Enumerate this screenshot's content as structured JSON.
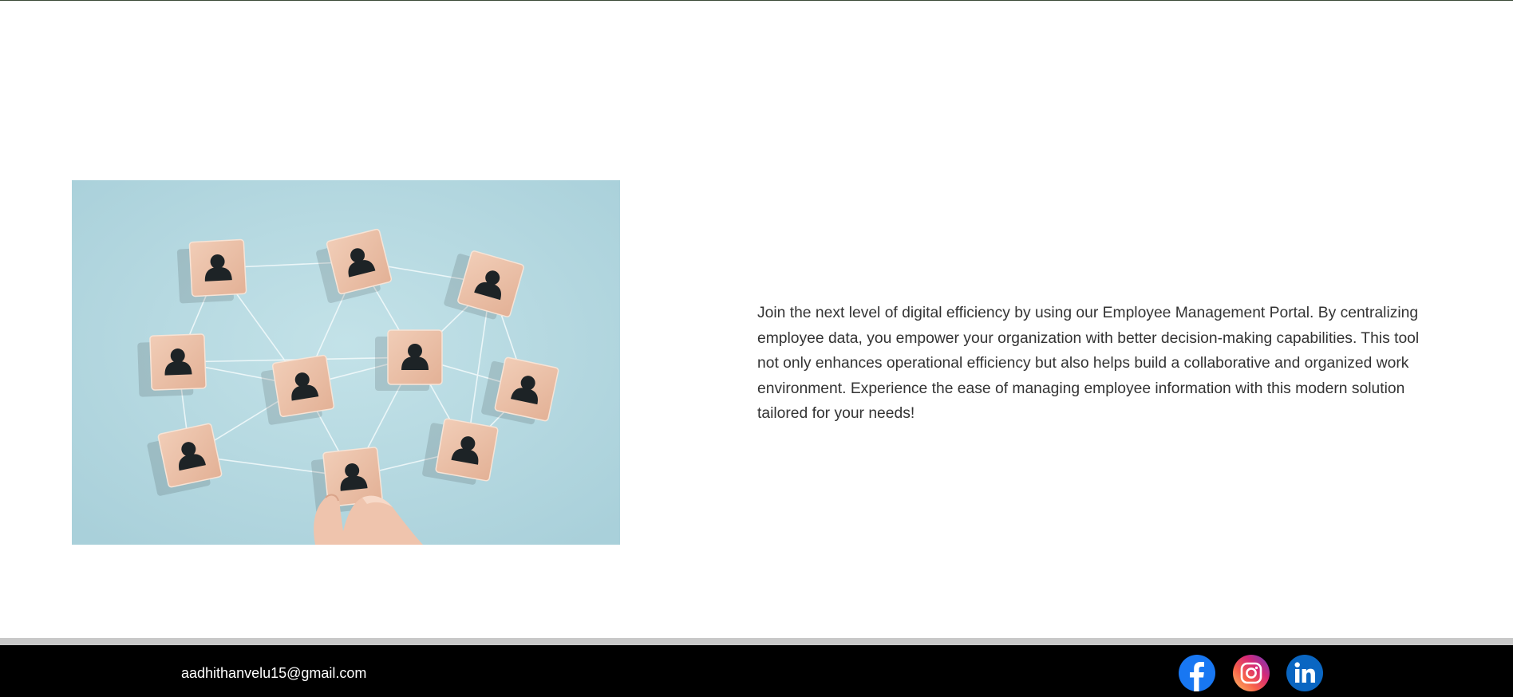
{
  "hero": {
    "image_alt": "Wooden blocks with person icons connected by lines, hand placing a block",
    "intro_text": "Join the next level of digital efficiency by using our Employee Management Portal. By centralizing employee data, you empower your organization with better decision-making capabilities. This tool not only enhances operational efficiency but also helps build a collaborative and organized work environment. Experience the ease of managing employee information with this modern solution tailored for your needs!"
  },
  "footer": {
    "email": "aadhithanvelu15@gmail.com",
    "social": [
      {
        "name": "facebook-icon",
        "color": "#1877f2"
      },
      {
        "name": "instagram-icon",
        "color": "#e1306c"
      },
      {
        "name": "linkedin-icon",
        "color": "#0a66c2"
      }
    ]
  },
  "colors": {
    "footer_bg": "#000000",
    "footer_text": "#ffffff",
    "body_text": "#333333",
    "image_bg": "#b9dbe2"
  }
}
